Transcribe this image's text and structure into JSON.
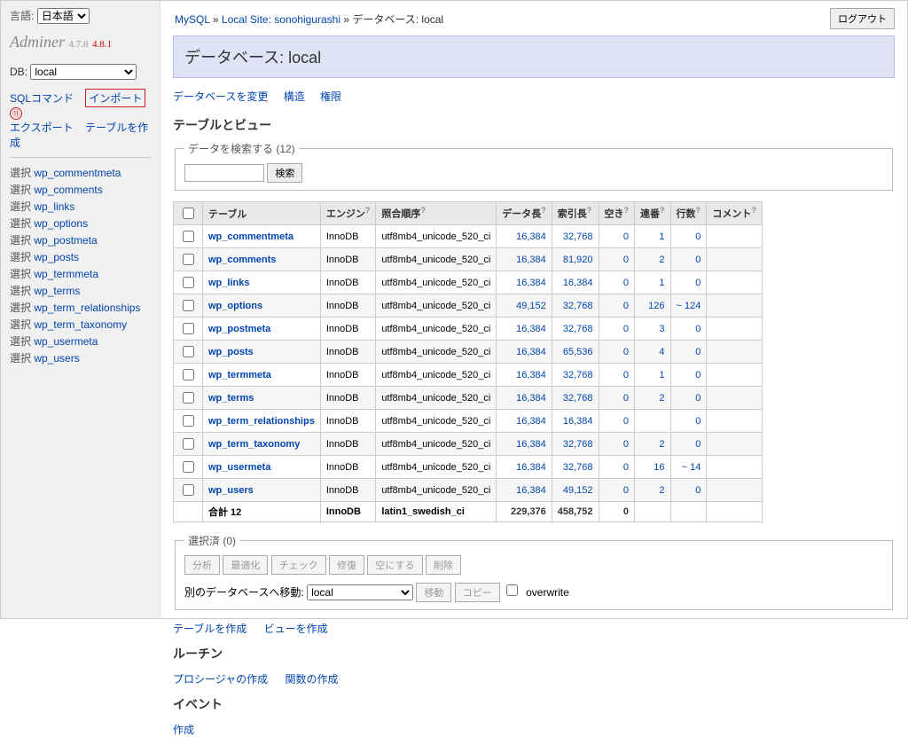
{
  "lang": {
    "label": "言語:",
    "selected": "日本語"
  },
  "logo": {
    "name": "Adminer",
    "v1": "4.7.8",
    "v2": "4.8.1"
  },
  "db": {
    "label": "DB:",
    "selected": "local"
  },
  "sideLinks": {
    "sqlCommand": "SQLコマンド",
    "import": "インポート",
    "annotation": "⑪",
    "export": "エクスポート",
    "createTable": "テーブルを作成"
  },
  "sideTablesPrefix": "選択",
  "sideTables": [
    "wp_commentmeta",
    "wp_comments",
    "wp_links",
    "wp_options",
    "wp_postmeta",
    "wp_posts",
    "wp_termmeta",
    "wp_terms",
    "wp_term_relationships",
    "wp_term_taxonomy",
    "wp_usermeta",
    "wp_users"
  ],
  "breadcrumb": {
    "a": "MySQL",
    "b": "Local Site: sonohigurashi",
    "c": "データベース: local",
    "sep": " » "
  },
  "logout": "ログアウト",
  "pageTitle": "データベース: local",
  "topLinks": {
    "changeDb": "データベースを変更",
    "structure": "構造",
    "privileges": "権限"
  },
  "sections": {
    "tablesViews": "テーブルとビュー",
    "routines": "ルーチン",
    "events": "イベント"
  },
  "search": {
    "legend": "データを検索する (12)",
    "btn": "検索"
  },
  "thead": {
    "table": "テーブル",
    "engine": "エンジン",
    "collation": "照合順序",
    "dataLen": "データ長",
    "indexLen": "索引長",
    "free": "空き",
    "autoInc": "連番",
    "rows": "行数",
    "comment": "コメント"
  },
  "rows": [
    {
      "name": "wp_commentmeta",
      "engine": "InnoDB",
      "coll": "utf8mb4_unicode_520_ci",
      "dl": "16,384",
      "il": "32,768",
      "free": "0",
      "ai": "1",
      "rows": "0"
    },
    {
      "name": "wp_comments",
      "engine": "InnoDB",
      "coll": "utf8mb4_unicode_520_ci",
      "dl": "16,384",
      "il": "81,920",
      "free": "0",
      "ai": "2",
      "rows": "0"
    },
    {
      "name": "wp_links",
      "engine": "InnoDB",
      "coll": "utf8mb4_unicode_520_ci",
      "dl": "16,384",
      "il": "16,384",
      "free": "0",
      "ai": "1",
      "rows": "0"
    },
    {
      "name": "wp_options",
      "engine": "InnoDB",
      "coll": "utf8mb4_unicode_520_ci",
      "dl": "49,152",
      "il": "32,768",
      "free": "0",
      "ai": "126",
      "rows": "~ 124"
    },
    {
      "name": "wp_postmeta",
      "engine": "InnoDB",
      "coll": "utf8mb4_unicode_520_ci",
      "dl": "16,384",
      "il": "32,768",
      "free": "0",
      "ai": "3",
      "rows": "0"
    },
    {
      "name": "wp_posts",
      "engine": "InnoDB",
      "coll": "utf8mb4_unicode_520_ci",
      "dl": "16,384",
      "il": "65,536",
      "free": "0",
      "ai": "4",
      "rows": "0"
    },
    {
      "name": "wp_termmeta",
      "engine": "InnoDB",
      "coll": "utf8mb4_unicode_520_ci",
      "dl": "16,384",
      "il": "32,768",
      "free": "0",
      "ai": "1",
      "rows": "0"
    },
    {
      "name": "wp_terms",
      "engine": "InnoDB",
      "coll": "utf8mb4_unicode_520_ci",
      "dl": "16,384",
      "il": "32,768",
      "free": "0",
      "ai": "2",
      "rows": "0"
    },
    {
      "name": "wp_term_relationships",
      "engine": "InnoDB",
      "coll": "utf8mb4_unicode_520_ci",
      "dl": "16,384",
      "il": "16,384",
      "free": "0",
      "ai": "",
      "rows": "0"
    },
    {
      "name": "wp_term_taxonomy",
      "engine": "InnoDB",
      "coll": "utf8mb4_unicode_520_ci",
      "dl": "16,384",
      "il": "32,768",
      "free": "0",
      "ai": "2",
      "rows": "0"
    },
    {
      "name": "wp_usermeta",
      "engine": "InnoDB",
      "coll": "utf8mb4_unicode_520_ci",
      "dl": "16,384",
      "il": "32,768",
      "free": "0",
      "ai": "16",
      "rows": "~ 14"
    },
    {
      "name": "wp_users",
      "engine": "InnoDB",
      "coll": "utf8mb4_unicode_520_ci",
      "dl": "16,384",
      "il": "49,152",
      "free": "0",
      "ai": "2",
      "rows": "0"
    }
  ],
  "tfoot": {
    "label": "合計 12",
    "engine": "InnoDB",
    "coll": "latin1_swedish_ci",
    "dl": "229,376",
    "il": "458,752",
    "free": "0"
  },
  "selectedFs": {
    "legend": "選択済 (0)",
    "analyze": "分析",
    "optimize": "最適化",
    "check": "チェック",
    "repair": "修復",
    "truncate": "空にする",
    "drop": "削除",
    "moveLabel": "別のデータベースへ移動:",
    "moveSelected": "local",
    "move": "移動",
    "copy": "コピー",
    "overwrite": "overwrite"
  },
  "afterLinks": {
    "createTable": "テーブルを作成",
    "createView": "ビューを作成"
  },
  "routineLinks": {
    "createProc": "プロシージャの作成",
    "createFunc": "関数の作成"
  },
  "eventLinks": {
    "create": "作成"
  }
}
